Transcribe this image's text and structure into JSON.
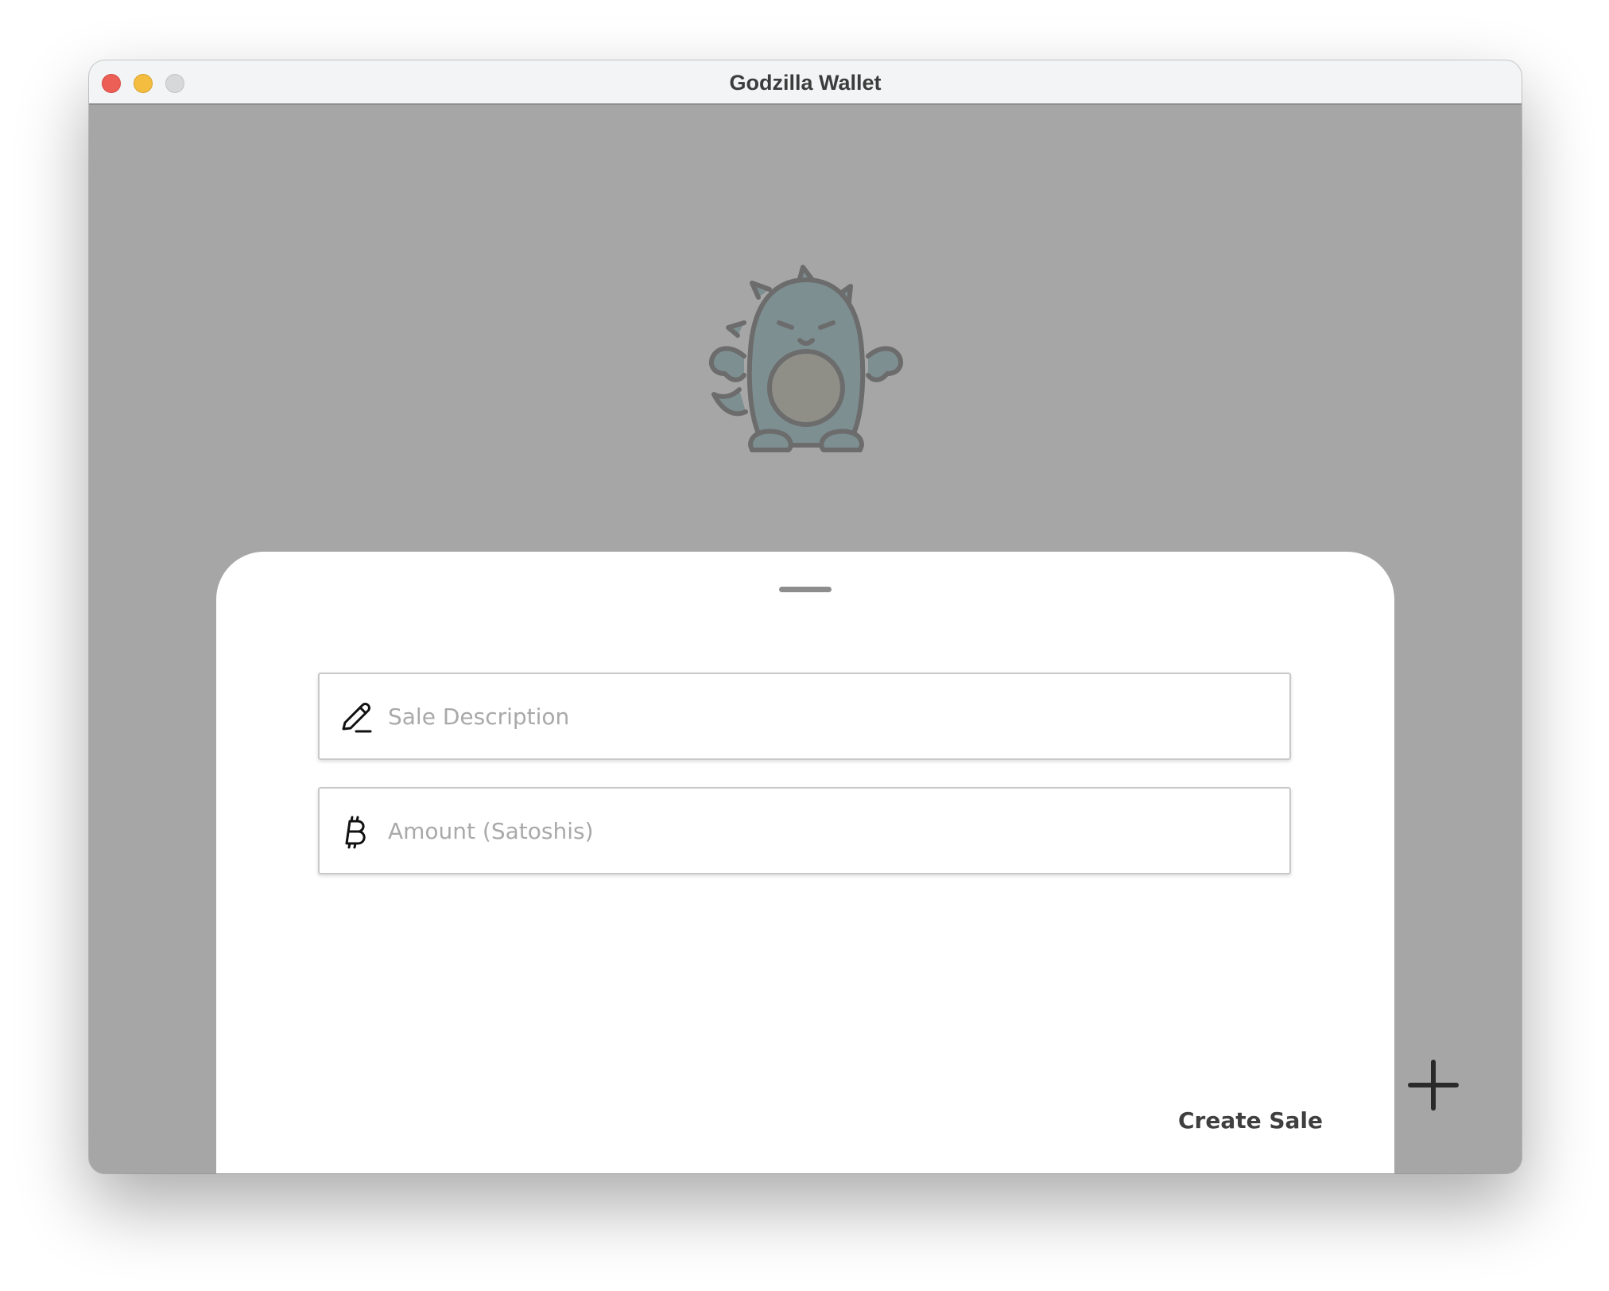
{
  "window": {
    "title": "Godzilla Wallet",
    "traffic_lights": {
      "close_color": "#ec5f57",
      "minimize_color": "#f4bd3f",
      "zoom_color": "#d6d8da"
    }
  },
  "mascot": {
    "icon": "godzilla-mascot-icon"
  },
  "sheet": {
    "handle_icon": "drag-handle",
    "fields": [
      {
        "icon": "pencil-icon",
        "placeholder": "Sale Description",
        "value": ""
      },
      {
        "icon": "bitcoin-icon",
        "placeholder": "Amount (Satoshis)",
        "value": ""
      }
    ],
    "create_label": "Create Sale"
  },
  "fab": {
    "icon": "plus-icon"
  },
  "colors": {
    "overlay": "#a6a6a6",
    "sheet_background": "#ffffff",
    "text_dark": "#3f3f3f",
    "placeholder": "#a9a9a9"
  }
}
